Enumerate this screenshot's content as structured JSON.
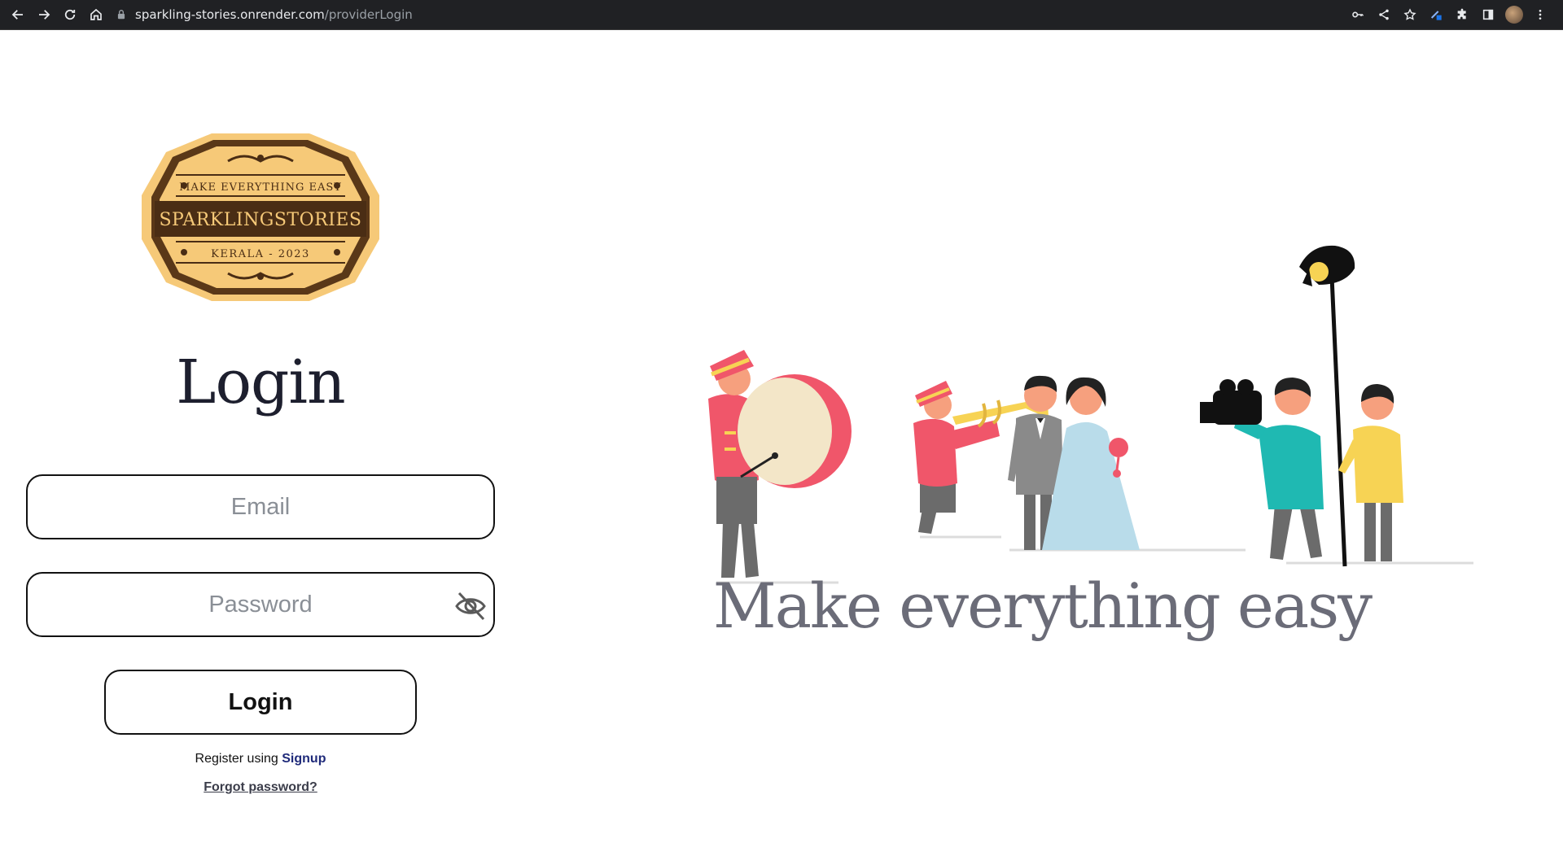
{
  "browser": {
    "url_host": "sparkling-stories.onrender.com",
    "url_path": "/providerLogin"
  },
  "logo": {
    "top_text": "MAKE EVERYTHING EASY",
    "brand_text": "SPARKLINGSTORIES",
    "bottom_text": "KERALA - 2023"
  },
  "login": {
    "title": "Login",
    "email_placeholder": "Email",
    "password_placeholder": "Password",
    "button_label": "Login",
    "register_prefix": "Register using ",
    "signup_label": "Signup",
    "forgot_label": "Forgot password?"
  },
  "hero": {
    "tagline": "Make everything easy"
  },
  "colors": {
    "chrome_bg": "#202124",
    "logo_gold": "#f6c978",
    "logo_brown": "#4a2d14",
    "band_red": "#f0566a",
    "teal": "#1fb9b2",
    "yellow": "#f7d354"
  }
}
